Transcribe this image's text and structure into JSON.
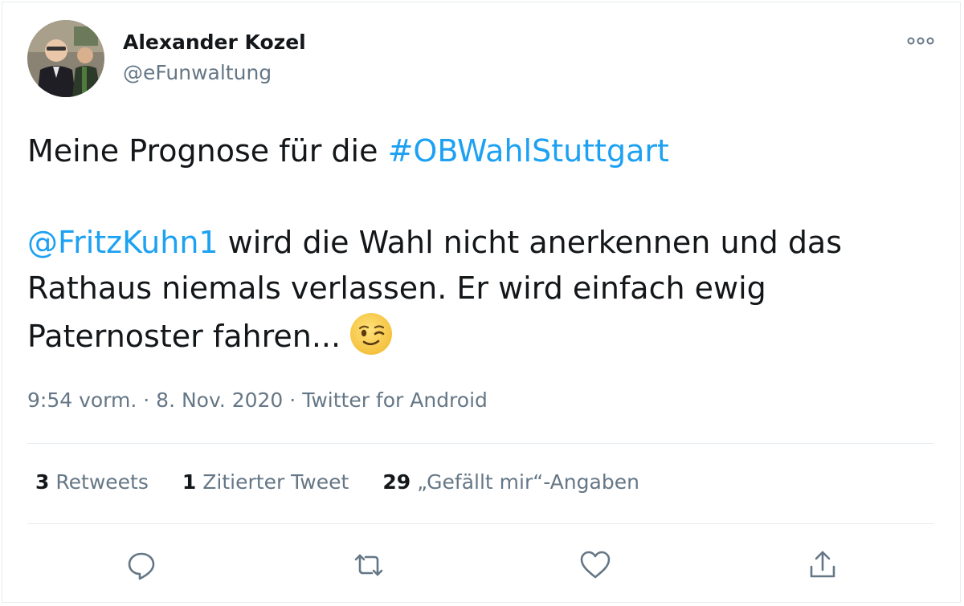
{
  "author": {
    "name": "Alexander Kozel",
    "handle": "@eFunwaltung",
    "avatar_icon": "profile-photo"
  },
  "more_icon": "more-options-icon",
  "tweet": {
    "line1_prefix": "Meine Prognose für die ",
    "hashtag": "#OBWahlStuttgart",
    "mention": "@FritzKuhn1",
    "body_after_mention": " wird die Wahl nicht anerkennen und das Rathaus niemals verlassen. Er wird einfach ewig Paternoster fahren...",
    "emoji_icon": "winking-face-emoji"
  },
  "meta": {
    "time": "9:54 vorm.",
    "sep1": " · ",
    "date": "8. Nov. 2020",
    "sep2": " · ",
    "source": "Twitter for Android"
  },
  "stats": {
    "retweets": {
      "count": "3",
      "label": "Retweets"
    },
    "quotes": {
      "count": "1",
      "label": "Zitierter Tweet"
    },
    "likes": {
      "count": "29",
      "label": "„Gefällt mir“-Angaben"
    }
  },
  "actions": {
    "reply_icon": "reply-icon",
    "retweet_icon": "retweet-icon",
    "like_icon": "heart-icon",
    "share_icon": "share-icon"
  },
  "colors": {
    "link": "#1da1f2",
    "secondary_text": "#657786",
    "primary_text": "#14171a",
    "divider": "#e6ecf0"
  }
}
